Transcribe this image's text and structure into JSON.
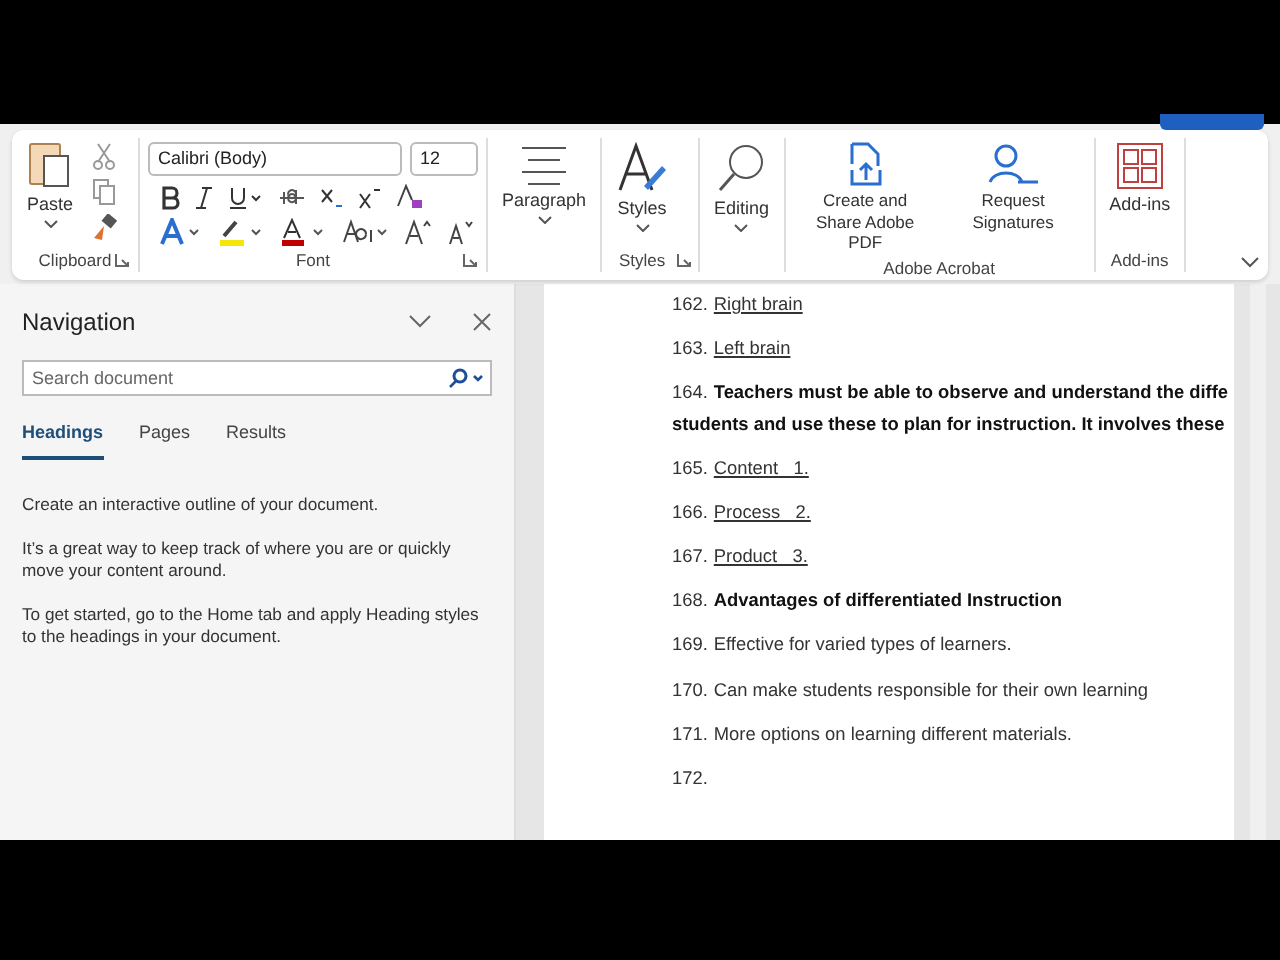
{
  "ribbon": {
    "groups": [
      {
        "kind": "clipboard",
        "label": "Clipboard",
        "paste": "Paste"
      },
      {
        "kind": "font",
        "label": "Font",
        "font_name": "Calibri (Body)",
        "font_size": "12"
      },
      {
        "kind": "paragraph",
        "button": "Paragraph"
      },
      {
        "kind": "styles",
        "label": "Styles",
        "button": "Styles"
      },
      {
        "kind": "editing",
        "button": "Editing"
      },
      {
        "kind": "acrobat",
        "label": "Adobe Acrobat",
        "buttons": [
          "Create and Share Adobe PDF",
          "Request Signatures"
        ]
      },
      {
        "kind": "addins",
        "label": "Add-ins",
        "button": "Add-ins"
      }
    ]
  },
  "navigation": {
    "title": "Navigation",
    "search": {
      "placeholder": "Search document"
    },
    "tabs": [
      {
        "label": "Headings",
        "selected": true
      },
      {
        "label": "Pages",
        "selected": false
      },
      {
        "label": "Results",
        "selected": false
      }
    ],
    "paragraphs": [
      "Create an interactive outline of your document.",
      "It’s a great way to keep track of where you are or quickly move your content around.",
      "To get started, go to the Home tab and apply Heading styles to the headings in your document."
    ]
  },
  "document": {
    "lines": [
      {
        "number": "162.",
        "text": "Right brain",
        "underlined": true,
        "bold": false
      },
      {
        "number": "163.",
        "text": "Left brain",
        "underlined": true,
        "bold": false
      },
      {
        "number": "164.",
        "text": "Teachers must be able to observe and understand the diffe",
        "underlined": false,
        "bold": true,
        "continuation": "students and use these to plan for instruction. It involves these"
      },
      {
        "number": "165.",
        "text": "Content   1.",
        "underlined": true,
        "bold": false
      },
      {
        "number": "166.",
        "text": "Process   2.",
        "underlined": true,
        "bold": false
      },
      {
        "number": "167.",
        "text": "Product   3.",
        "underlined": true,
        "bold": false
      },
      {
        "number": "168.",
        "text": "Advantages of differentiated Instruction",
        "underlined": false,
        "bold": true
      },
      {
        "number": "169.",
        "text": "Effective for varied types of learners.",
        "underlined": false,
        "bold": false
      },
      {
        "number": "170.",
        "text": "Can make students responsible for their own learning",
        "underlined": false,
        "bold": false
      },
      {
        "number": "171.",
        "text": "More options on learning different materials.",
        "underlined": false,
        "bold": false
      },
      {
        "number": "172."
      }
    ]
  }
}
